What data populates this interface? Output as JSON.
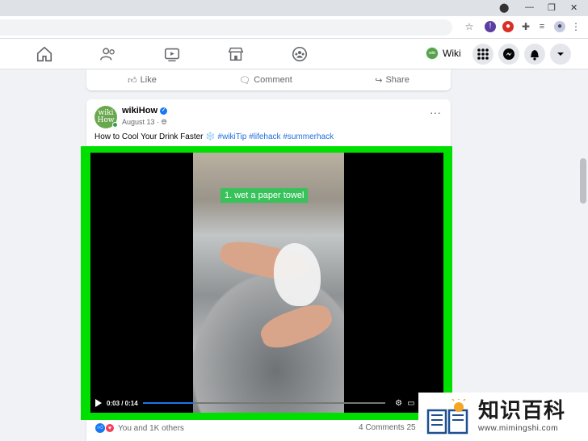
{
  "browser": {
    "window_controls": [
      "—",
      "❐",
      "✕"
    ],
    "toolbar_icons": [
      "star-icon",
      "extension-purple-icon",
      "extension-red-icon",
      "puzzle-icon",
      "reading-list-icon",
      "profile-icon",
      "menu-icon"
    ]
  },
  "nav": {
    "page_name": "Wiki",
    "page_avatar_text": "wiki How",
    "icons": [
      "home-icon",
      "friends-icon",
      "watch-icon",
      "marketplace-icon",
      "groups-icon"
    ],
    "right_buttons": [
      "apps-grid-icon",
      "messenger-icon",
      "notifications-icon",
      "account-chevron-icon"
    ]
  },
  "prev_post": {
    "like": "Like",
    "comment": "Comment",
    "share": "Share"
  },
  "post": {
    "author": "wikiHow",
    "logo_top": "wiki",
    "logo_bottom": "How",
    "date": "August 13 · ",
    "caption_text": "How to Cool Your Drink Faster",
    "caption_emoji": "❄️",
    "hashtags": [
      "#wikiTip",
      "#lifehack",
      "#summerhack"
    ],
    "more": "···"
  },
  "video": {
    "overlay_label": "1. wet a paper towel",
    "time": "0:03 / 0:14",
    "progress": 0.21,
    "frame_color": "#00e000"
  },
  "engagement": {
    "reactions_text": "You and 1K others",
    "comments_text": "4 Comments  25"
  },
  "watermark": {
    "cn": "知识百科",
    "url": "www.mimingshi.com"
  }
}
